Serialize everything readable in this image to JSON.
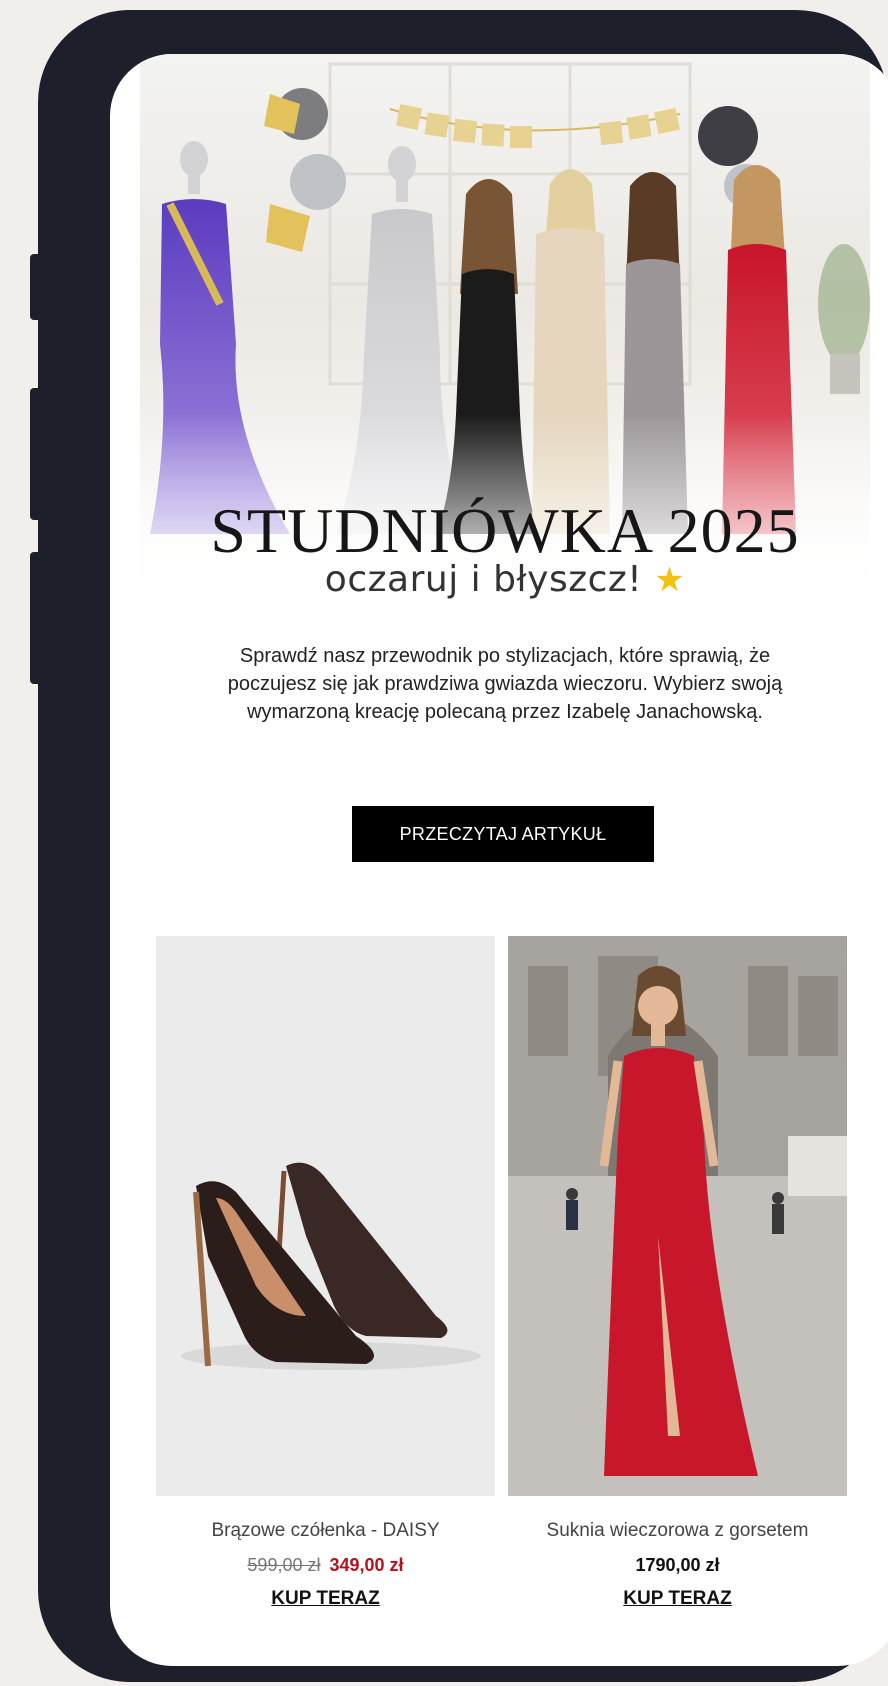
{
  "hero": {
    "banner_text": "STUDNIÓWKA 2025",
    "title": "STUDNIÓWKA 2025",
    "subtitle": "oczaruj i błyszcz!",
    "subtitle_icon": "star-icon"
  },
  "description": "Sprawdź nasz przewodnik po stylizacjach, które sprawią, że poczujesz się jak prawdziwa gwiazda wieczoru. Wybierz swoją wymarzoną kreację polecaną przez Izabelę Janachowską.",
  "cta_label": "PRZECZYTAJ ARTYKUŁ",
  "products": [
    {
      "name": "Brązowe czółenka - DAISY",
      "old_price": "599,00 zł",
      "price": "349,00 zł",
      "buy_label": "KUP TERAZ"
    },
    {
      "name": "Suknia wieczorowa z gorsetem",
      "price": "1790,00 zł",
      "buy_label": "KUP TERAZ"
    }
  ],
  "colors": {
    "sale_price": "#b5121b",
    "cta_background": "#000000",
    "phone_frame": "#1d1f2b"
  }
}
